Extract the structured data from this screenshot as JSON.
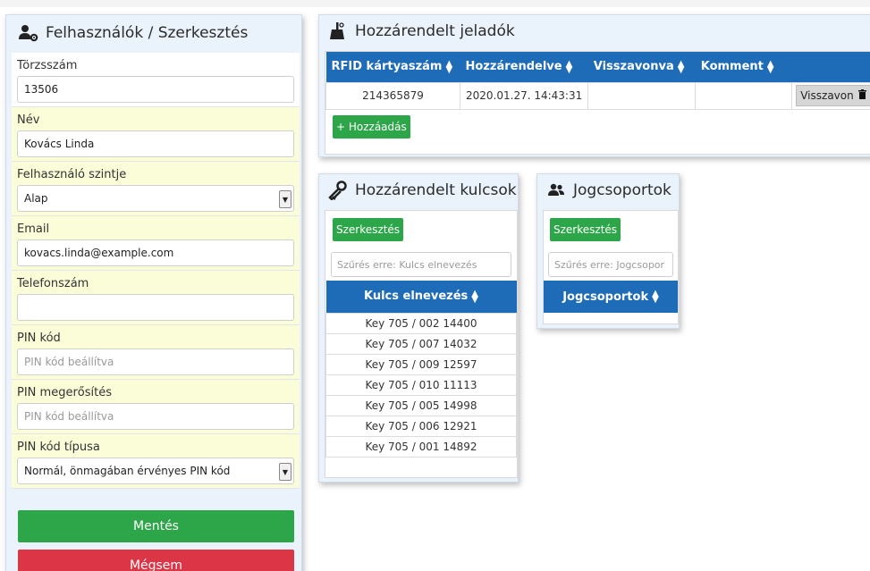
{
  "user_form": {
    "title": "Felhasználók / Szerkesztés",
    "fields": {
      "torzsszam": {
        "label": "Törzsszám",
        "value": "13506"
      },
      "nev": {
        "label": "Név",
        "value": "Kovács Linda"
      },
      "szint": {
        "label": "Felhasználó szintje",
        "value": "Alap"
      },
      "email": {
        "label": "Email",
        "value": "kovacs.linda@example.com"
      },
      "telefon": {
        "label": "Telefonszám",
        "value": ""
      },
      "pin": {
        "label": "PIN kód",
        "placeholder": "PIN kód beállítva"
      },
      "pin_confirm": {
        "label": "PIN megerősítés",
        "placeholder": "PIN kód beállítva"
      },
      "pin_type": {
        "label": "PIN kód típusa",
        "value": "Normál, önmagában érvényes PIN kód"
      }
    },
    "save_label": "Mentés",
    "cancel_label": "Mégsem"
  },
  "transmitters": {
    "title": "Hozzárendelt jeladók",
    "columns": [
      "RFID kártyaszám",
      "Hozzárendelve",
      "Visszavonva",
      "Komment"
    ],
    "rows": [
      {
        "rfid": "214365879",
        "assigned": "2020.01.27. 14:43:31",
        "revoked": "",
        "comment": "",
        "action": "Visszavon"
      }
    ],
    "add_label": "+ Hozzáadás"
  },
  "keys": {
    "title": "Hozzárendelt kulcsok",
    "edit_label": "Szerkesztés",
    "filter_placeholder": "Szűrés erre: Kulcs elnevezés",
    "column": "Kulcs elnevezés",
    "items": [
      "Key 705 / 002 14400",
      "Key 705 / 007 14032",
      "Key 705 / 009 12597",
      "Key 705 / 010 11113",
      "Key 705 / 005 14998",
      "Key 705 / 006 12921",
      "Key 705 / 001 14892"
    ]
  },
  "groups": {
    "title": "Jogcsoportok",
    "edit_label": "Szerkesztés",
    "filter_placeholder": "Szűrés erre: Jogcsopor",
    "column": "Jogcsoportok"
  },
  "colors": {
    "header_blue": "#1e6bb8",
    "green": "#2da64a",
    "red": "#dc3545",
    "panel_bg": "#eaf2fb",
    "required_bg": "#fbfcd8"
  }
}
